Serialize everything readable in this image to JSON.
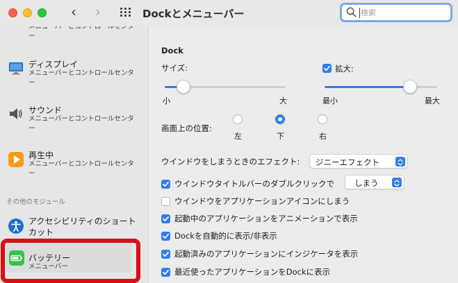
{
  "window": {
    "title": "Dockとメニューバー"
  },
  "search": {
    "placeholder": "検索"
  },
  "sidebar": {
    "items": [
      {
        "title": "",
        "subtitle": "メニューバーとコントロールセンター"
      },
      {
        "title": "ディスプレイ",
        "subtitle": "メニューバーとコントロールセンター"
      },
      {
        "title": "サウンド",
        "subtitle": "メニューバーとコントロールセンター"
      },
      {
        "title": "再生中",
        "subtitle": "メニューバーとコントロールセンター"
      }
    ],
    "section_label": "その他のモジュール",
    "other": [
      {
        "title": "アクセシビリティのショートカット",
        "subtitle": ""
      },
      {
        "title": "バッテリー",
        "subtitle": "メニューバー"
      }
    ]
  },
  "dock": {
    "heading": "Dock",
    "size_label": "サイズ:",
    "size_min": "小",
    "size_max": "大",
    "size_value": 0.12,
    "magnify_label": "拡大:",
    "magnify_checked": true,
    "magnify_min": "最小",
    "magnify_max": "最大",
    "magnify_value": 0.8,
    "position_label": "画面上の位置:",
    "positions": [
      "左",
      "下",
      "右"
    ],
    "position_selected": "下",
    "minimize_label": "ウインドウをしまうときのエフェクト:",
    "minimize_effect": "ジニーエフェクト",
    "double_click_label": "ウインドウタイトルバーのダブルクリックで",
    "double_click_action": "しまう",
    "options": [
      {
        "label": "ウインドウをアプリケーションアイコンにしまう",
        "checked": false
      },
      {
        "label": "起動中のアプリケーションをアニメーションで表示",
        "checked": true
      },
      {
        "label": "Dockを自動的に表示/非表示",
        "checked": true
      },
      {
        "label": "起動済みのアプリケーションにインジケータを表示",
        "checked": true
      },
      {
        "label": "最近使ったアプリケーションをDockに表示",
        "checked": true
      }
    ]
  },
  "colors": {
    "accent": "#2f7cf6",
    "highlight_box": "#d60f17"
  }
}
